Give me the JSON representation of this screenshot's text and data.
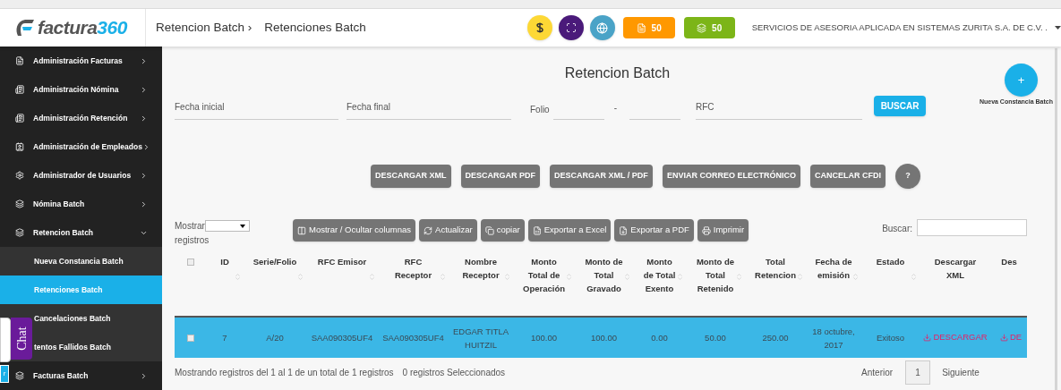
{
  "logo": {
    "text": "factura",
    "accent": "360"
  },
  "breadcrumb": [
    "Retencion Batch ›",
    "Retenciones Batch"
  ],
  "header": {
    "badges": [
      "50",
      "50"
    ],
    "company": "SERVICIOS DE ASESORIA APLICADA EN SISTEMAS ZURITA S.A. DE C.V. ."
  },
  "sidebar": {
    "items": [
      {
        "label": "Administración Facturas",
        "expanded": false
      },
      {
        "label": "Administración Nómina",
        "expanded": false
      },
      {
        "label": "Administración Retención",
        "expanded": false
      },
      {
        "label": "Administración de Empleados",
        "expanded": false
      },
      {
        "label": "Administrador de Usuarios",
        "expanded": false
      },
      {
        "label": "Nómina Batch",
        "expanded": false
      },
      {
        "label": "Retencion Batch",
        "expanded": true,
        "children": [
          {
            "label": "Nueva Constancia Batch",
            "selected": false
          },
          {
            "label": "Retenciones Batch",
            "selected": true
          },
          {
            "label": "Cancelaciones Batch",
            "selected": false
          },
          {
            "label": "tentos Fallidos Batch",
            "selected": false
          }
        ]
      },
      {
        "label": "Facturas Batch",
        "expanded": false
      }
    ]
  },
  "chat_widget": {
    "label": "Chat",
    "button": "r"
  },
  "page_title": "Retencion Batch",
  "fab": {
    "icon_text": "+",
    "caption": "Nueva Constancia Batch"
  },
  "filters": {
    "fecha_inicial": "Fecha inicial",
    "fecha_final": "Fecha final",
    "folio": "Folio",
    "separator": "-",
    "rfc": "RFC",
    "search_button": "BUSCAR"
  },
  "actions": [
    "DESCARGAR XML",
    "DESCARGAR PDF",
    "DESCARGAR XML / PDF",
    "ENVIAR CORREO ELECTRÓNICO",
    "CANCELAR CFDI"
  ],
  "help_button": "?",
  "table_tools": {
    "show_label": "Mostrar",
    "show_suffix": "registros",
    "buttons": [
      "Mostrar / Ocultar columnas",
      "Actualizar",
      "copiar",
      "Exportar a Excel",
      "Exportar a PDF",
      "Imprimir"
    ],
    "search_label": "Buscar:"
  },
  "table": {
    "select_all_checked": false,
    "columns": [
      "ID",
      "Serie/Folio",
      "RFC Emisor",
      "RFC Receptor",
      "Nombre Receptor",
      "Monto Total de Operación",
      "Monto de Total Gravado",
      "Monto de Total Exento",
      "Monto de Total Retenido",
      "Total Retencion",
      "Fecha de emisión",
      "Estado",
      "Descargar XML",
      "Des"
    ],
    "rows": [
      {
        "selected": true,
        "checked": false,
        "cells": [
          "7",
          "A/20",
          "SAA090305UF4",
          "SAA090305UF4",
          "EDGAR TITLA HUITZIL",
          "100.00",
          "100.00",
          "0.00",
          "50.00",
          "250.00",
          "18 octubre, 2017",
          "Exitoso"
        ],
        "links": [
          "DESCARGAR",
          "DE"
        ]
      }
    ]
  },
  "footer": {
    "info": "Mostrando registros del 1 al 1 de un total de 1 registros",
    "selected_info": "0 registros Seleccionados",
    "prev": "Anterior",
    "page": "1",
    "next": "Siguiente"
  }
}
